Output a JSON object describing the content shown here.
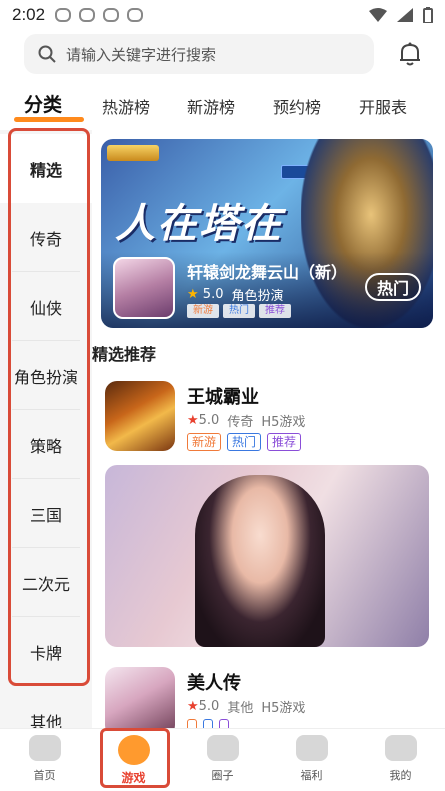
{
  "status_bar": {
    "time": "2:02"
  },
  "search": {
    "placeholder": "请输入关键字进行搜索"
  },
  "top_tabs": [
    "分类",
    "热游榜",
    "新游榜",
    "预约榜",
    "开服表"
  ],
  "sidebar": {
    "items": [
      "精选",
      "传奇",
      "仙侠",
      "角色扮演",
      "策略",
      "三国",
      "二次元",
      "卡牌",
      "其他"
    ]
  },
  "banner": {
    "title": "人在塔在",
    "game_name": "轩辕剑龙舞云山（新）",
    "rating": "5.0",
    "genre": "角色扮演",
    "tags": [
      "新游",
      "热门",
      "推荐"
    ],
    "hot_button": "热门"
  },
  "section": {
    "title": "精选推荐"
  },
  "games": [
    {
      "title": "王城霸业",
      "rating": "5.0",
      "genre": "传奇",
      "platform": "H5游戏",
      "tags": [
        "新游",
        "热门",
        "推荐"
      ]
    },
    {
      "title": "美人传",
      "rating": "5.0",
      "genre": "其他",
      "platform": "H5游戏",
      "tags": [
        "",
        "",
        ""
      ]
    }
  ],
  "bottom_nav": [
    "首页",
    "游戏",
    "圈子",
    "福利",
    "我的"
  ],
  "colors": {
    "accent": "#ff8a1c",
    "highlight_frame": "#d94b38",
    "tag_new": "#f07a3a",
    "tag_hot": "#3a78e0",
    "tag_rec": "#8a4ed8"
  }
}
